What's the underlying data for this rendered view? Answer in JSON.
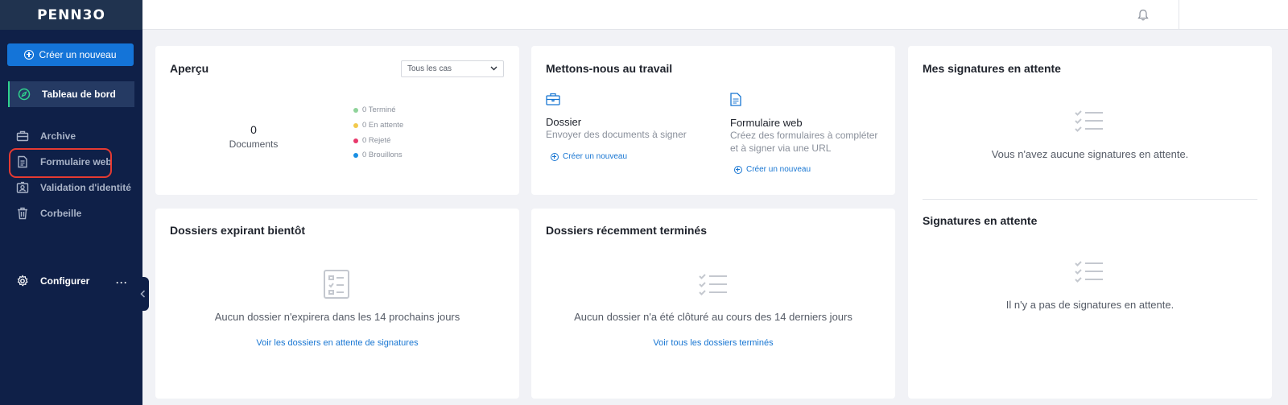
{
  "brand": {
    "logo": "PENN3O"
  },
  "sidebar": {
    "create_label": "Créer un nouveau",
    "items": [
      {
        "label": "Tableau de bord",
        "icon": "compass-icon"
      },
      {
        "label": "Archive",
        "icon": "briefcase-icon"
      },
      {
        "label": "Formulaire web",
        "icon": "document-icon"
      },
      {
        "label": "Validation d'identité",
        "icon": "id-badge-icon"
      },
      {
        "label": "Corbeille",
        "icon": "trash-icon"
      }
    ],
    "settings_label": "Configurer",
    "more_label": "···"
  },
  "overview": {
    "title": "Aperçu",
    "filter_value": "Tous les cas",
    "count": "0",
    "count_label": "Documents",
    "legend": [
      {
        "label": "0 Terminé",
        "color": "#8fd39a"
      },
      {
        "label": "0 En attente",
        "color": "#f2c94c"
      },
      {
        "label": "0 Rejeté",
        "color": "#e8386b"
      },
      {
        "label": "0 Brouillons",
        "color": "#1a8fe3"
      }
    ]
  },
  "get_started": {
    "title": "Mettons-nous au travail",
    "dossier": {
      "title": "Dossier",
      "description": "Envoyer des documents à signer",
      "link": "Créer un nouveau"
    },
    "webform": {
      "title": "Formulaire web",
      "description": "Créez des formulaires à compléter et à signer via une URL",
      "link": "Créer un nouveau"
    }
  },
  "my_signatures": {
    "title": "Mes signatures en attente",
    "empty": "Vous n'avez aucune signatures en attente."
  },
  "pending_signatures": {
    "title": "Signatures en attente",
    "empty": "Il n'y a pas de signatures en attente."
  },
  "expiring": {
    "title": "Dossiers expirant bientôt",
    "empty": "Aucun dossier n'expirera dans les 14 prochains jours",
    "link": "Voir les dossiers en attente de signatures"
  },
  "recent": {
    "title": "Dossiers récemment terminés",
    "empty": "Aucun dossier n'a été clôturé au cours des 14 derniers jours",
    "link": "Voir tous les dossiers terminés"
  },
  "colors": {
    "sidebar": "#0f2048",
    "accent": "#1474d8",
    "active_marker": "#2fd38e",
    "highlight": "#e53a32"
  }
}
